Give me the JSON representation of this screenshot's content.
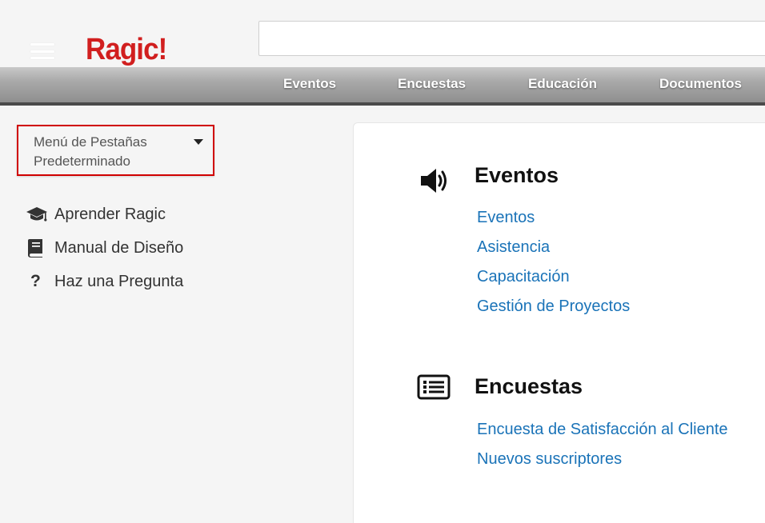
{
  "header": {
    "logo_text": "Ragic!",
    "search_value": ""
  },
  "nav": {
    "items": [
      "Eventos",
      "Encuestas",
      "Educación",
      "Documentos"
    ]
  },
  "sidebar": {
    "tab_menu_label": "Menú de Pestañas Predeterminado",
    "links": [
      {
        "label": "Aprender Ragic",
        "icon": "graduation-cap-icon"
      },
      {
        "label": "Manual de Diseño",
        "icon": "book-icon"
      },
      {
        "label": "Haz una Pregunta",
        "icon": "question-icon",
        "glyph": "?"
      }
    ]
  },
  "sections": [
    {
      "title": "Eventos",
      "icon": "speaker-icon",
      "links": [
        "Eventos",
        "Asistencia",
        "Capacitación",
        "Gestión de Proyectos"
      ]
    },
    {
      "title": "Encuestas",
      "icon": "list-icon",
      "links": [
        "Encuesta de Satisfacción al Cliente",
        "Nuevos suscriptores"
      ]
    }
  ],
  "colors": {
    "brand": "#d11f1f",
    "link": "#1a73b8",
    "highlight_border": "#d00000"
  }
}
